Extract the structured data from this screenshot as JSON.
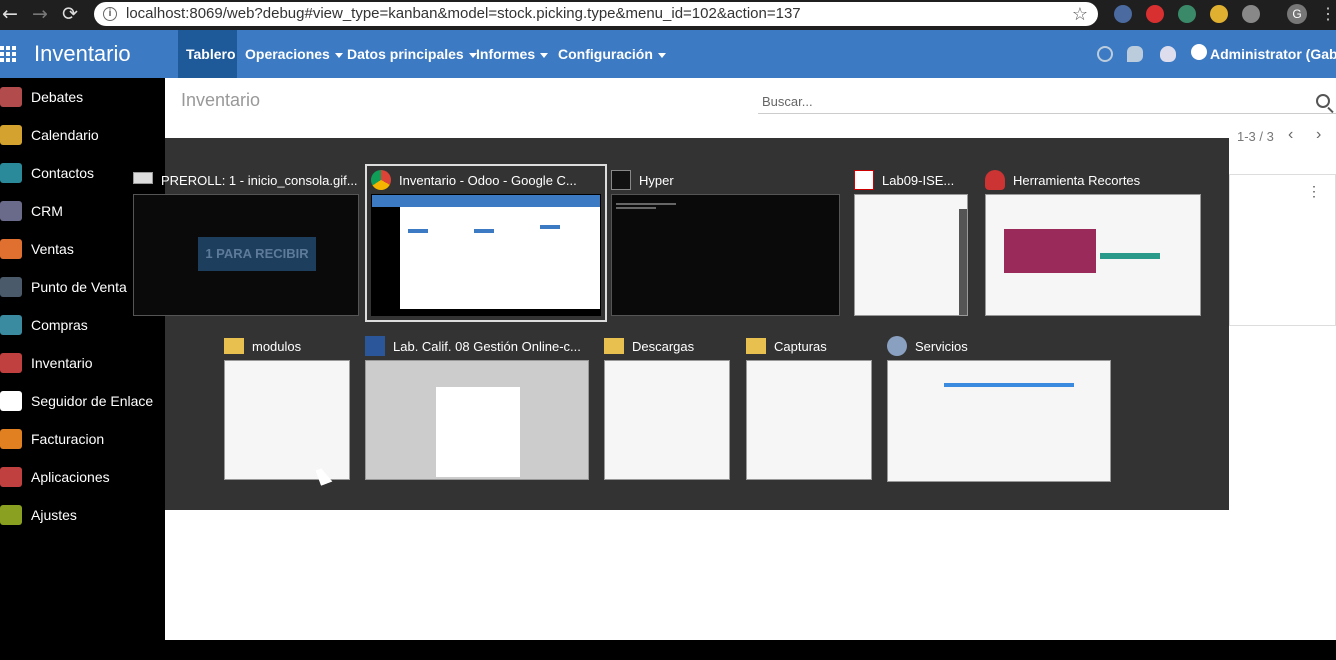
{
  "browser": {
    "back": "←",
    "forward": "→",
    "reload": "⟳",
    "info": "i",
    "url": "localhost:8069/web?debug#view_type=kanban&model=stock.picking.type&menu_id=102&action=137",
    "star": "☆",
    "profile_initial": "G",
    "menu": "⋮"
  },
  "topbar": {
    "brand": "Inventario",
    "menu": [
      {
        "label": "Tablero",
        "dropdown": false
      },
      {
        "label": "Operaciones",
        "dropdown": true
      },
      {
        "label": "Datos principales",
        "dropdown": true
      },
      {
        "label": "Informes",
        "dropdown": true
      },
      {
        "label": "Configuración",
        "dropdown": true
      }
    ],
    "user": "Administrator (Gabtim"
  },
  "sidebar": {
    "items": [
      {
        "label": "Debates",
        "color": "#b24b4b"
      },
      {
        "label": "Calendario",
        "color": "#d4a32f"
      },
      {
        "label": "Contactos",
        "color": "#2a8a9a"
      },
      {
        "label": "CRM",
        "color": "#6a6a8a"
      },
      {
        "label": "Ventas",
        "color": "#e07030"
      },
      {
        "label": "Punto de Venta",
        "color": "#4a5a6a"
      },
      {
        "label": "Compras",
        "color": "#3a8aa0"
      },
      {
        "label": "Inventario",
        "color": "#c04040"
      },
      {
        "label": "Seguidor de Enlace",
        "color": "#ffffff"
      },
      {
        "label": "Facturacion",
        "color": "#e08020"
      },
      {
        "label": "Aplicaciones",
        "color": "#c04040"
      },
      {
        "label": "Ajustes",
        "color": "#8aa020"
      }
    ]
  },
  "main": {
    "title": "Inventario",
    "search_placeholder": "Buscar...",
    "pager": "1-3 / 3",
    "pager_prev": "‹",
    "pager_next": "›",
    "card_menu": "⋮",
    "receive_button": "1 PARA RECIBIR"
  },
  "switcher": {
    "windows": [
      {
        "title": "PREROLL: 1 - inicio_consola.gif...",
        "icon": "gif-viewer-icon"
      },
      {
        "title": "Inventario - Odoo - Google C...",
        "icon": "chrome-icon",
        "selected": true
      },
      {
        "title": "Hyper",
        "icon": "terminal-icon"
      },
      {
        "title": "Lab09-ISE...",
        "icon": "pdf-icon"
      },
      {
        "title": "Herramienta Recortes",
        "icon": "snipping-tool-icon"
      },
      {
        "title": "modulos",
        "icon": "folder-icon"
      },
      {
        "title": "Lab. Calif. 08 Gestión Online-c...",
        "icon": "word-icon"
      },
      {
        "title": "Descargas",
        "icon": "folder-icon"
      },
      {
        "title": "Capturas",
        "icon": "folder-icon"
      },
      {
        "title": "Servicios",
        "icon": "gear-icon"
      }
    ]
  }
}
